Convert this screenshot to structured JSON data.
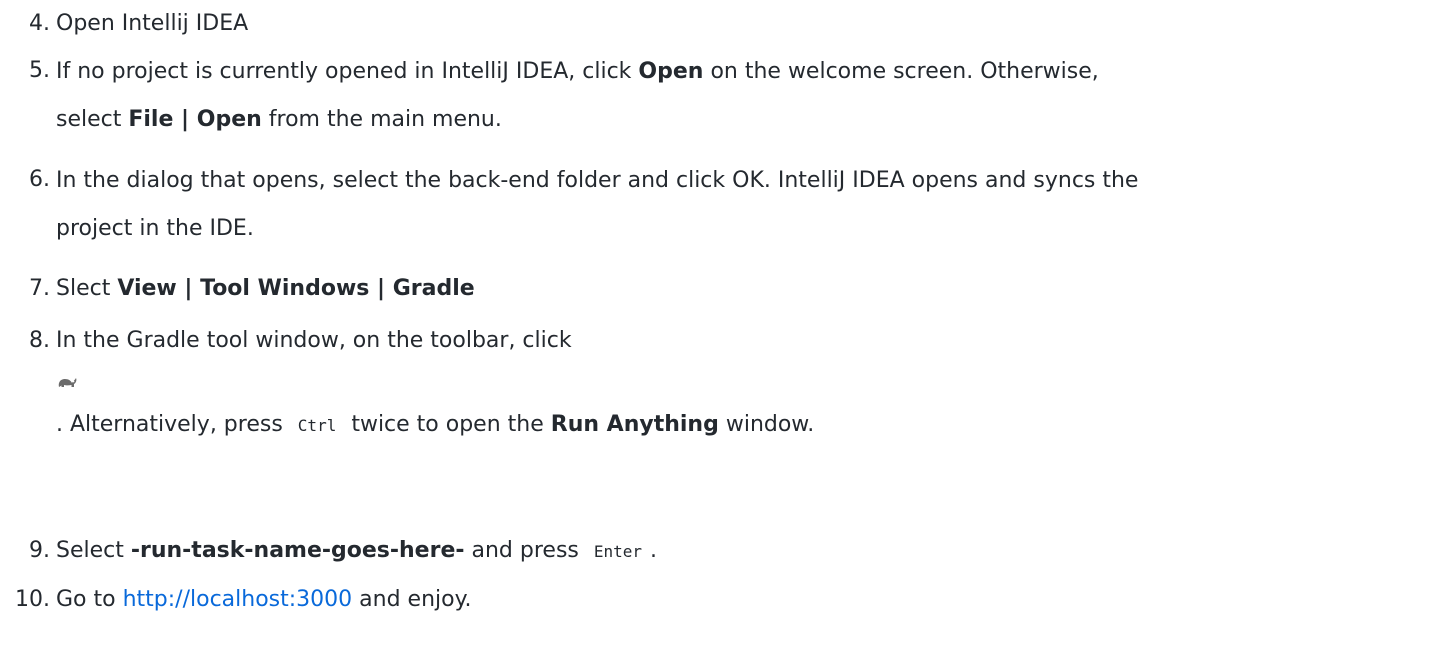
{
  "steps": [
    {
      "num": "4.",
      "text": "Open Intellij IDEA"
    },
    {
      "num": "5.",
      "line1_pre": "If no project is currently opened in IntelliJ IDEA, click ",
      "line1_bold": "Open",
      "line1_post": " on the welcome screen. Otherwise,",
      "line2_pre": "select ",
      "line2_bold": "File | Open",
      "line2_post": " from the main menu."
    },
    {
      "num": "6.",
      "line1": "In the dialog that opens, select the back-end folder and click OK. IntelliJ IDEA opens and syncs the",
      "line2": "project in the IDE."
    },
    {
      "num": "7.",
      "pre": "Slect ",
      "bold": "View | Tool Windows | Gradle"
    },
    {
      "num": "8.",
      "line1": "In the Gradle tool window, on the toolbar, click",
      "icon": "gradle-elephant-icon",
      "line3_pre": ". Alternatively, press ",
      "line3_code": "Ctrl",
      "line3_mid": " twice to open the ",
      "line3_bold": "Run Anything",
      "line3_post": " window."
    },
    {
      "num": "9.",
      "pre": "Select ",
      "bold": "-run-task-name-goes-here-",
      "mid": " and press ",
      "code": "Enter",
      "post": "."
    },
    {
      "num": "10.",
      "pre": "Go to ",
      "link": "http://localhost:3000",
      "post": " and enjoy."
    }
  ],
  "colors": {
    "text": "#24292f",
    "link": "#0969da"
  }
}
